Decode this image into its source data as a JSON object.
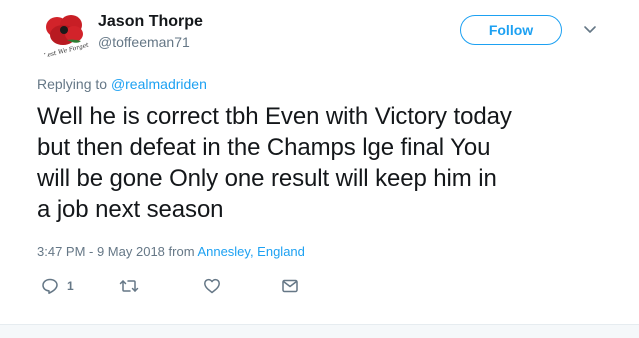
{
  "tweet": {
    "author": {
      "name": "Jason Thorpe",
      "handle": "@toffeeman71",
      "avatar_text": "Lest We Forget"
    },
    "follow_label": "Follow",
    "replying_prefix": "Replying to ",
    "replying_to": "@realmadriden",
    "text_lines": [
      "Well he is correct tbh Even with Victory today",
      "but then defeat in the Champs lge final You",
      "will be gone Only one result will keep him in",
      "a job next season"
    ],
    "timestamp": "3:47 PM - 9 May 2018",
    "from_label": "from",
    "location": "Annesley, England",
    "actions": {
      "reply_count": "1",
      "reply_icon": "reply-icon",
      "retweet_icon": "retweet-icon",
      "like_icon": "heart-icon",
      "dm_icon": "envelope-icon"
    }
  },
  "colors": {
    "accent": "#1da1f2",
    "secondary_text": "#657786",
    "primary_text": "#14171a",
    "poppy_red": "#d2232a"
  }
}
